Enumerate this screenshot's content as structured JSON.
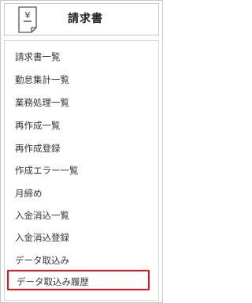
{
  "header": {
    "icon_symbol": "¥",
    "title": "請求書"
  },
  "menu": {
    "items": [
      {
        "label": "請求書一覧"
      },
      {
        "label": "勤怠集計一覧"
      },
      {
        "label": "業務処理一覧"
      },
      {
        "label": "再作成一覧"
      },
      {
        "label": "再作成登録"
      },
      {
        "label": "作成エラー一覧"
      },
      {
        "label": "月締め"
      },
      {
        "label": "入金消込一覧"
      },
      {
        "label": "入金消込登録"
      },
      {
        "label": "データ取込み"
      },
      {
        "label": "データ取込み履歴",
        "selected": true
      }
    ]
  },
  "colors": {
    "selected_border": "#e8141c",
    "border": "#c8c8c8",
    "text": "#333333"
  },
  "icons": {
    "header": "invoice-document-yen-icon"
  }
}
